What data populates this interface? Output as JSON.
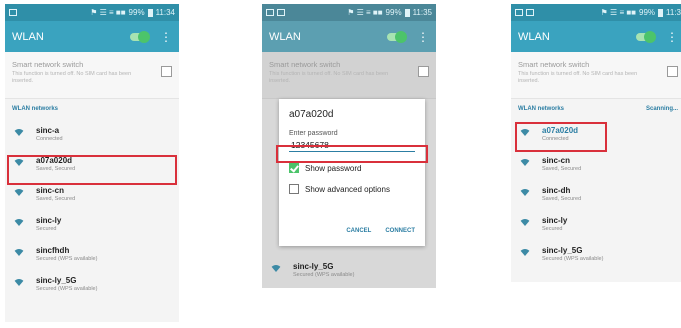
{
  "status": {
    "phone1_time": "11:34",
    "phone2_time": "11:35",
    "phone3_time": "11:3",
    "icons": "⚑ ☰ ≡ ■■",
    "battery_pct": "99%"
  },
  "appbar": {
    "title": "WLAN"
  },
  "smart_switch": {
    "title": "Smart network switch",
    "description": "This function is turned off. No SIM card has been inserted."
  },
  "section": {
    "title": "WLAN networks",
    "scanning": "Scanning..."
  },
  "phone1": {
    "networks": [
      {
        "name": "sinc-a",
        "status": "Connected"
      },
      {
        "name": "a07a020d",
        "status": "Saved, Secured"
      },
      {
        "name": "sinc-cn",
        "status": "Saved, Secured"
      },
      {
        "name": "sinc-ly",
        "status": "Secured"
      },
      {
        "name": "sincfhdh",
        "status": "Secured (WPS available)"
      },
      {
        "name": "sinc-ly_5G",
        "status": "Secured (WPS available)"
      }
    ]
  },
  "phone2": {
    "dialog": {
      "title": "a07a020d",
      "password_label": "Enter password",
      "password_value": "12345678",
      "show_password": "Show password",
      "show_advanced": "Show advanced options",
      "cancel": "CANCEL",
      "connect": "CONNECT"
    },
    "below": {
      "name": "sinc-ly_5G",
      "status": "Secured (WPS available)"
    }
  },
  "phone3": {
    "networks": [
      {
        "name": "a07a020d",
        "status": "Connected"
      },
      {
        "name": "sinc-cn",
        "status": "Saved, Secured"
      },
      {
        "name": "sinc-dh",
        "status": "Saved, Secured"
      },
      {
        "name": "sinc-ly",
        "status": "Secured"
      },
      {
        "name": "sinc-ly_5G",
        "status": "Secured (WPS available)"
      }
    ]
  },
  "colors": {
    "accent": "#3aa3bf",
    "highlight": "#d9303b",
    "toggle": "#4cc46a"
  }
}
